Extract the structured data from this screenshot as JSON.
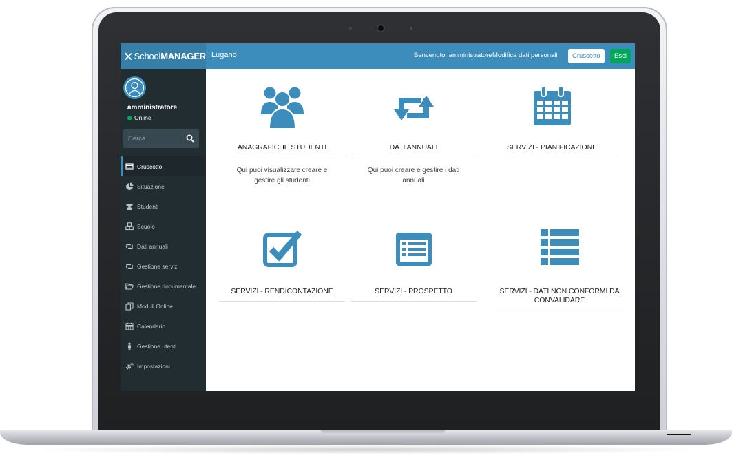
{
  "app": {
    "logo_prefix": "School",
    "logo_bold": "MANAGER",
    "city": "Lugano"
  },
  "header": {
    "welcome": "Benvenuto: amministratore",
    "edit_profile": "Modifica dati personali",
    "dashboard_button": "Cruscotto",
    "exit_button": "Esci"
  },
  "user": {
    "name": "amministratore",
    "status": "Online"
  },
  "search": {
    "placeholder": "Cerca"
  },
  "sidebar": {
    "items": [
      {
        "label": "Cruscotto",
        "icon": "dashboard-icon"
      },
      {
        "label": "Situazione",
        "icon": "pie-chart-icon"
      },
      {
        "label": "Studenti",
        "icon": "users-icon"
      },
      {
        "label": "Scuole",
        "icon": "cubes-icon"
      },
      {
        "label": "Dati annuali",
        "icon": "retweet-icon"
      },
      {
        "label": "Gestione servizi",
        "icon": "retweet-icon"
      },
      {
        "label": "Gestione documentale",
        "icon": "folder-open-icon"
      },
      {
        "label": "Moduli Online",
        "icon": "copy-icon"
      },
      {
        "label": "Calendario",
        "icon": "calendar-icon"
      },
      {
        "label": "Gestione utenti",
        "icon": "user-icon"
      },
      {
        "label": "Impostazioni",
        "icon": "cogs-icon"
      }
    ]
  },
  "cards": [
    {
      "title": "ANAGRAFICHE STUDENTI",
      "desc": "Qui puoi visualizzare creare e gestire gli studenti",
      "icon": "users-icon"
    },
    {
      "title": "DATI ANNUALI",
      "desc": "Qui puoi creare e gestire i dati annuali",
      "icon": "retweet-icon"
    },
    {
      "title": "SERVIZI - PIANIFICAZIONE",
      "desc": "",
      "icon": "calendar-icon"
    },
    {
      "title": "SERVIZI - RENDICONTAZIONE",
      "desc": "",
      "icon": "check-square-icon"
    },
    {
      "title": "SERVIZI - PROSPETTO",
      "desc": "",
      "icon": "list-alt-icon"
    },
    {
      "title": "SERVIZI - DATI NON CONFORMI DA CONVALIDARE",
      "desc": "",
      "icon": "list-icon"
    }
  ],
  "colors": {
    "header": "#3c8dbc",
    "logo": "#367fa9",
    "sidebar": "#222d32",
    "icon": "#3c8dbc",
    "online": "#00a65a",
    "exit": "#00a65a"
  }
}
